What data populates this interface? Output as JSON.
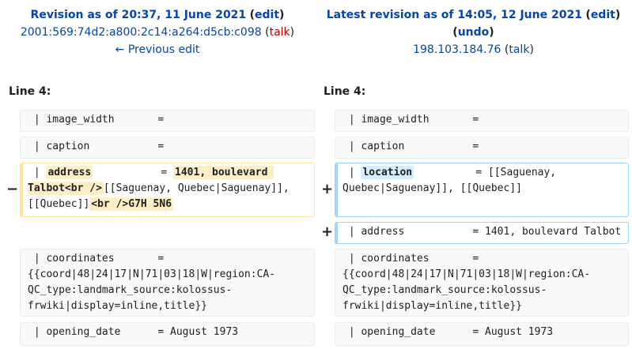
{
  "left_header": {
    "title": "Revision as of 20:37, 11 June 2021",
    "edit": "edit",
    "user": "2001:569:74d2:a800:2c14:a264:d5cb:c098",
    "talk": "talk",
    "prev": "← Previous edit"
  },
  "right_header": {
    "title": "Latest revision as of 14:05, 12 June 2021",
    "edit": "edit",
    "undo": "undo",
    "user": "198.103.184.76",
    "talk": "talk"
  },
  "left_line": "Line 4:",
  "right_line": "Line 4:",
  "markers": {
    "minus": "−",
    "plus1": "+",
    "plus2": "+"
  },
  "rows": {
    "r1_left": " | image_width       =",
    "r1_right": " | image_width       =",
    "r2_left": " | caption           =",
    "r2_right": " | caption           =",
    "del_pre": " | ",
    "del_word": "address",
    "del_mid": "           = ",
    "del_hl1": "1401, boulevard Talbot<br />",
    "del_mid2": "[[Saguenay, Quebec|Saguenay]], [[Quebec]]",
    "del_hl2": "<br />G7H 5N6",
    "ins_pre": " | ",
    "ins_word": "location",
    "ins_rest": "          = [[Saguenay, Quebec|Saguenay]], [[Quebec]]",
    "ins2": " | address           = 1401, boulevard Talbot",
    "coord_left": " | coordinates       =\n{{coord|48|24|17|N|71|03|18|W|region:CA-QC_type:landmark_source:kolossus-frwiki|display=inline,title}}",
    "coord_right": " | coordinates       =\n{{coord|48|24|17|N|71|03|18|W|region:CA-QC_type:landmark_source:kolossus-frwiki|display=inline,title}}",
    "open_left": " | opening_date      = August 1973",
    "open_right": " | opening_date      = August 1973"
  }
}
